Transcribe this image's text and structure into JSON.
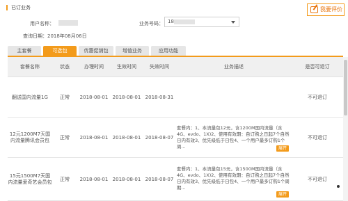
{
  "header": {
    "title": "已订业务",
    "review_button": "我要评价"
  },
  "info": {
    "user_label": "用户名称：",
    "business_label": "业务号码：",
    "business_value": "18",
    "query_label": "查询日期：",
    "query_value": "2018年08月06日"
  },
  "tabs": [
    {
      "label": "主套餐"
    },
    {
      "label": "可选包"
    },
    {
      "label": "优惠促销包"
    },
    {
      "label": "增值业务"
    },
    {
      "label": "应用功能"
    }
  ],
  "table": {
    "headers": [
      "套餐名称",
      "状态",
      "办理时间",
      "生效时间",
      "失效时间",
      "业务描述",
      "是否可退订"
    ],
    "rows": [
      {
        "name": "翻送国内流量1G",
        "status": "正常",
        "apply": "2018-08-01",
        "effective": "2018-08-01",
        "expire": "2018-08-31",
        "desc": "",
        "expand": "",
        "cancel": "不可退订"
      },
      {
        "name": "12元1200M7天国内流量腾讯会员包",
        "status": "正常",
        "apply": "2018-08-01",
        "effective": "2018-08-01",
        "expire": "2018-08-07",
        "desc": "套餐内：1、本流量包12元，含1200M国内流量（含4G、evdo、1X)2、使用有效期：自订购之日起7个自然日内有效3、优先级低于日包4、一个用户最多订购1个周...",
        "expand": "展开",
        "cancel": "不可退订"
      },
      {
        "name": "15元1500M7天国内流量爱奇艺会员包",
        "status": "正常",
        "apply": "2018-08-01",
        "effective": "2018-08-01",
        "expire": "2018-08-07",
        "desc": "套餐内：1、本流量包15元，含1500M国内流量（含4G、evdo、1X)2、使用有效期：自订购之日起7个自然日内有效3、优先级低于日包4、一个用户最多订购1个周期...",
        "expand": "展开",
        "cancel": "不可退订"
      }
    ]
  },
  "colors": {
    "accent": "#f39b1b",
    "accent_text": "#e8750c"
  }
}
